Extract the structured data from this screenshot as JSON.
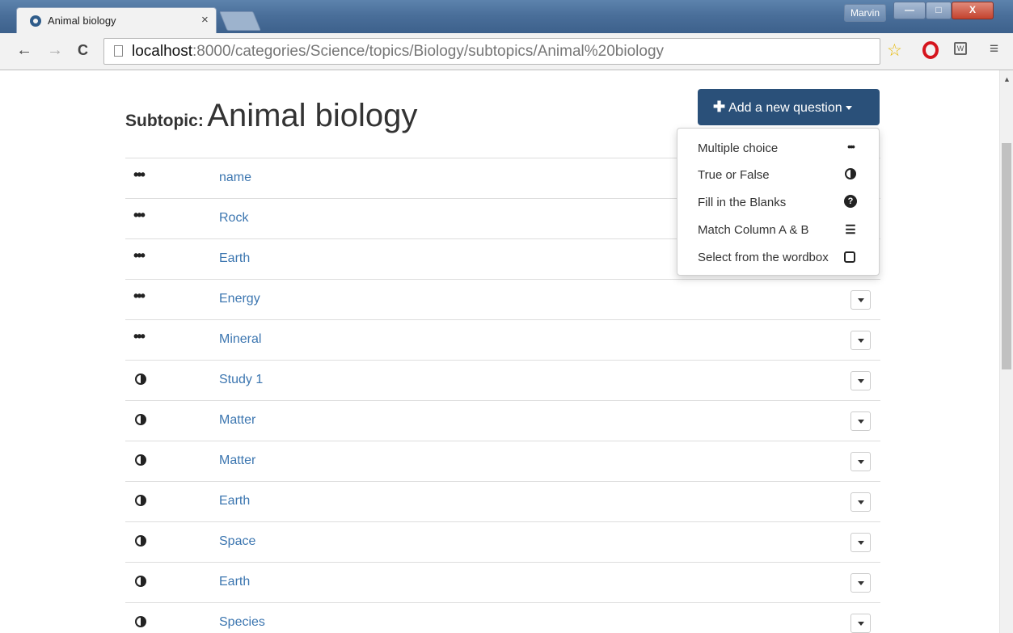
{
  "browser": {
    "tab_title": "Animal biology",
    "tab_close": "×",
    "user": "Marvin",
    "win_min": "—",
    "win_max": "□",
    "win_close": "X",
    "back": "←",
    "forward": "→",
    "reload": "C",
    "url_host": "localhost",
    "url_rest": ":8000/categories/Science/topics/Biology/subtopics/Animal%20biology",
    "menu": "≡",
    "star": "☆",
    "ext_label": "W"
  },
  "page": {
    "heading_label": "Subtopic:",
    "heading_name": "Animal biology",
    "add_button_label": "Add a new question",
    "add_button_plus": "✚"
  },
  "dropdown": {
    "items": [
      {
        "label": "Multiple choice",
        "icon": "ellipsis-icon"
      },
      {
        "label": "True or False",
        "icon": "half-circle-icon"
      },
      {
        "label": "Fill in the Blanks",
        "icon": "question-circle-icon"
      },
      {
        "label": "Match Column A & B",
        "icon": "list-icon"
      },
      {
        "label": "Select from the wordbox",
        "icon": "box-icon"
      }
    ]
  },
  "questions": [
    {
      "type": "multiple-choice",
      "name": "name"
    },
    {
      "type": "multiple-choice",
      "name": "Rock"
    },
    {
      "type": "multiple-choice",
      "name": "Earth"
    },
    {
      "type": "multiple-choice",
      "name": "Energy"
    },
    {
      "type": "multiple-choice",
      "name": "Mineral"
    },
    {
      "type": "true-false",
      "name": "Study 1"
    },
    {
      "type": "true-false",
      "name": "Matter"
    },
    {
      "type": "true-false",
      "name": "Matter"
    },
    {
      "type": "true-false",
      "name": "Earth"
    },
    {
      "type": "true-false",
      "name": "Space"
    },
    {
      "type": "true-false",
      "name": "Earth"
    },
    {
      "type": "true-false",
      "name": "Species"
    }
  ],
  "icons": {
    "ellipsis": "•••",
    "question": "?",
    "list": "☰"
  }
}
